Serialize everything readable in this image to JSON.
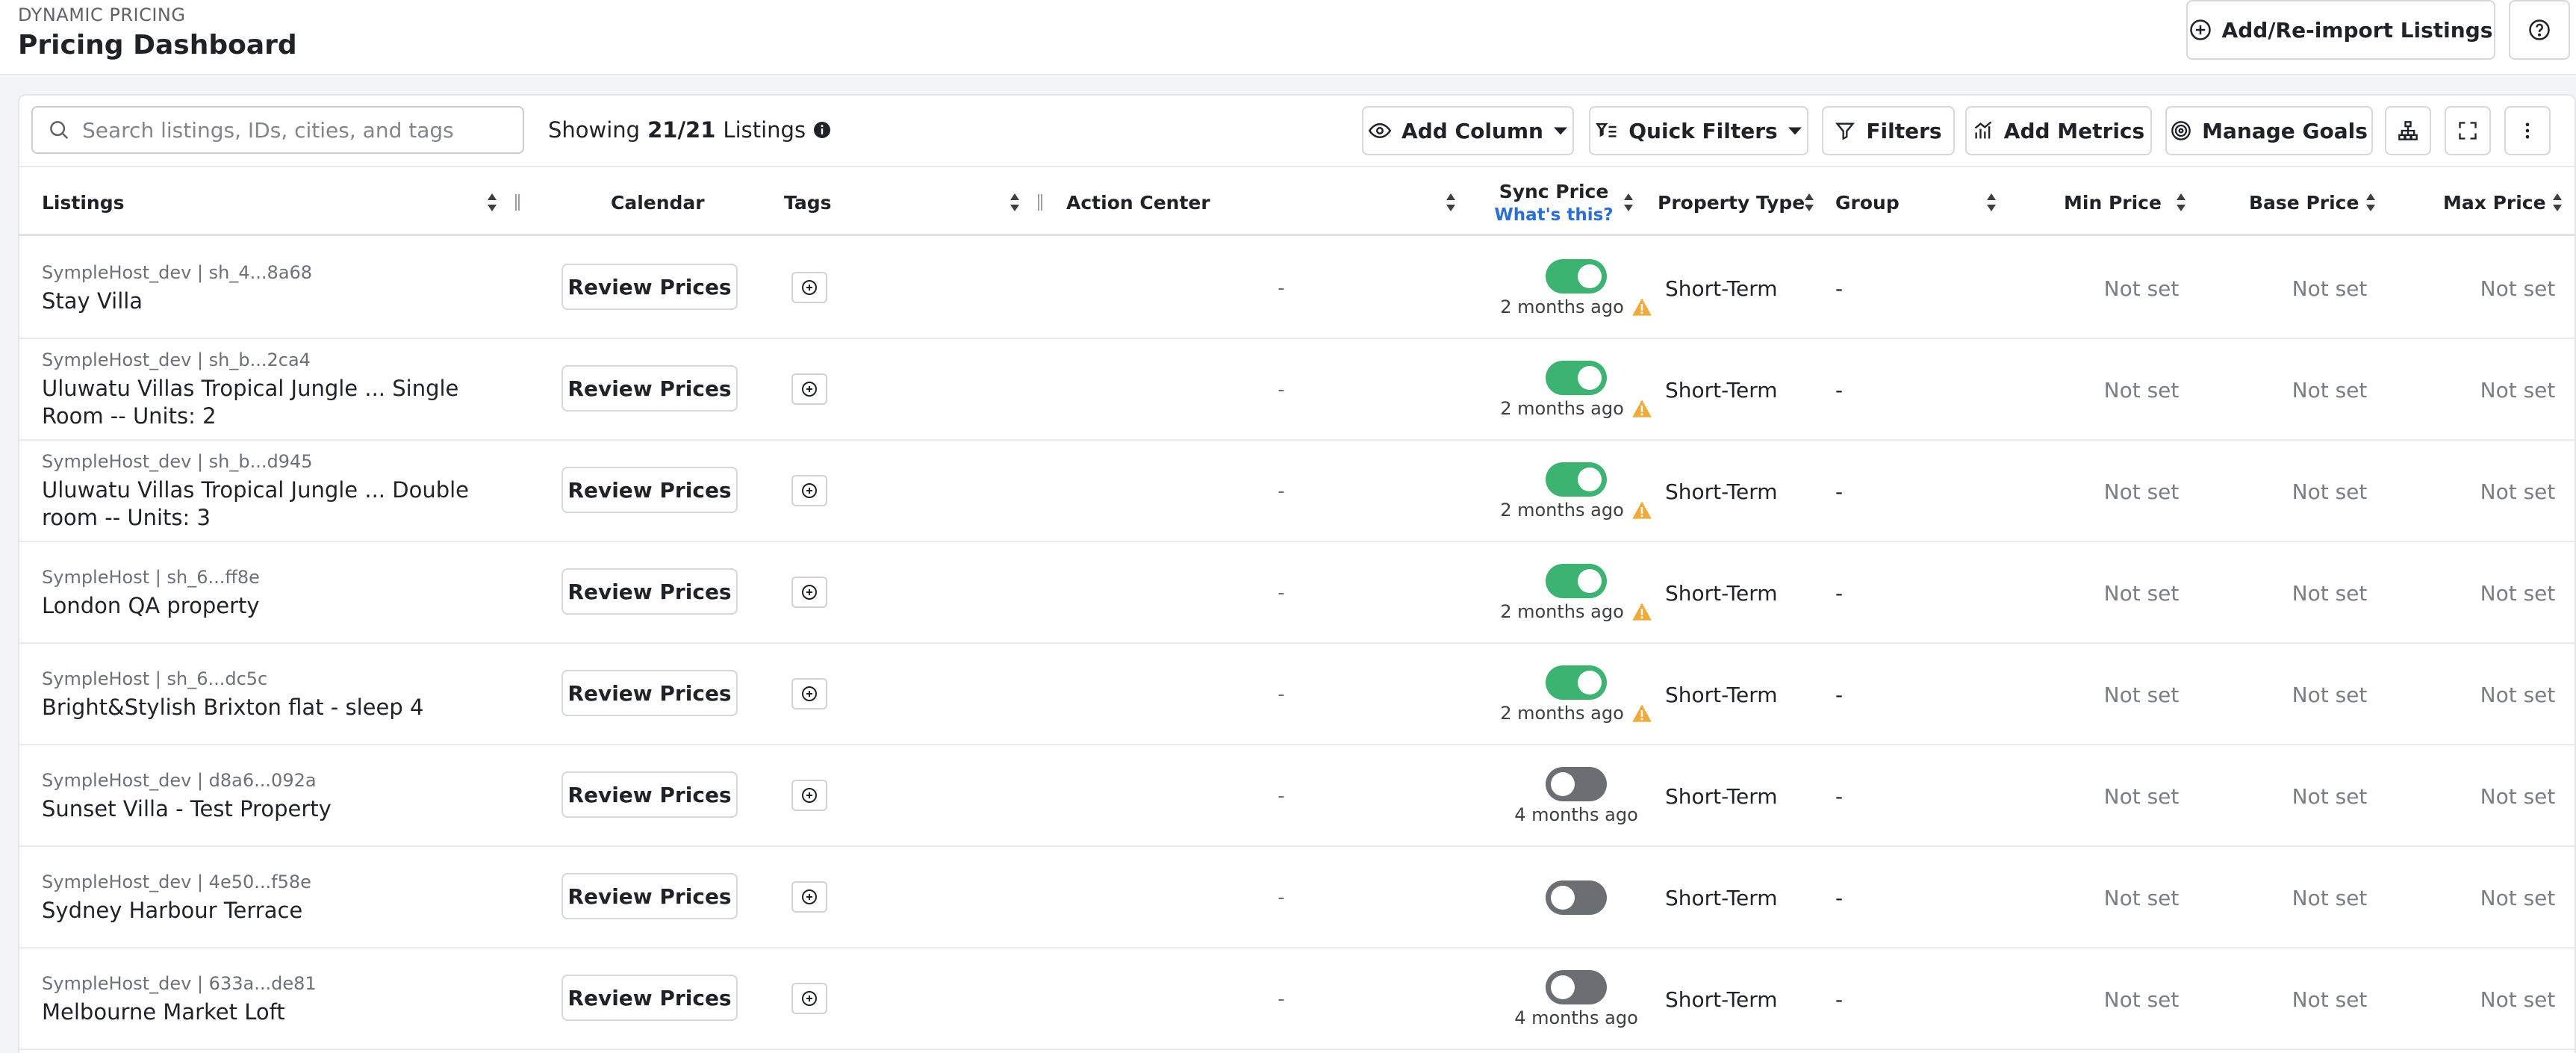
{
  "header": {
    "eyebrow": "DYNAMIC PRICING",
    "title": "Pricing Dashboard",
    "import_label": "Add/Re-import Listings"
  },
  "toolbar": {
    "search_placeholder": "Search listings, IDs, cities, and tags",
    "showing_prefix": "Showing",
    "showing_count": "21/21",
    "showing_suffix": "Listings",
    "add_column": "Add Column",
    "quick_filters": "Quick Filters",
    "filters": "Filters",
    "add_metrics": "Add Metrics",
    "manage_goals": "Manage Goals"
  },
  "columns": {
    "listings": "Listings",
    "calendar": "Calendar",
    "tags": "Tags",
    "action_center": "Action Center",
    "sync_price": "Sync Price",
    "sync_help": "What's this?",
    "property_type": "Property Type",
    "group": "Group",
    "min_price": "Min Price",
    "base_price": "Base Price",
    "max_price": "Max Price"
  },
  "row_labels": {
    "review": "Review Prices",
    "empty": "-"
  },
  "rows": [
    {
      "meta": "SympleHost_dev | sh_4...8a68",
      "name": "Stay Villa",
      "sync_on": true,
      "sync_time": "2 months ago",
      "warning": true,
      "property_type": "Short-Term",
      "group": "-",
      "min_price": "Not set",
      "base_price": "Not set",
      "max_price": "Not set"
    },
    {
      "meta": "SympleHost_dev | sh_b...2ca4",
      "name": "Uluwatu Villas Tropical Jungle ... Single Room -- Units: 2",
      "sync_on": true,
      "sync_time": "2 months ago",
      "warning": true,
      "property_type": "Short-Term",
      "group": "-",
      "min_price": "Not set",
      "base_price": "Not set",
      "max_price": "Not set"
    },
    {
      "meta": "SympleHost_dev | sh_b...d945",
      "name": "Uluwatu Villas Tropical Jungle ... Double room -- Units: 3",
      "sync_on": true,
      "sync_time": "2 months ago",
      "warning": true,
      "property_type": "Short-Term",
      "group": "-",
      "min_price": "Not set",
      "base_price": "Not set",
      "max_price": "Not set"
    },
    {
      "meta": "SympleHost | sh_6...ff8e",
      "name": "London QA property",
      "sync_on": true,
      "sync_time": "2 months ago",
      "warning": true,
      "property_type": "Short-Term",
      "group": "-",
      "min_price": "Not set",
      "base_price": "Not set",
      "max_price": "Not set"
    },
    {
      "meta": "SympleHost | sh_6...dc5c",
      "name": "Bright&Stylish Brixton flat - sleep 4",
      "sync_on": true,
      "sync_time": "2 months ago",
      "warning": true,
      "property_type": "Short-Term",
      "group": "-",
      "min_price": "Not set",
      "base_price": "Not set",
      "max_price": "Not set"
    },
    {
      "meta": "SympleHost_dev | d8a6...092a",
      "name": "Sunset Villa - Test Property",
      "sync_on": false,
      "sync_time": "4 months ago",
      "warning": false,
      "property_type": "Short-Term",
      "group": "-",
      "min_price": "Not set",
      "base_price": "Not set",
      "max_price": "Not set"
    },
    {
      "meta": "SympleHost_dev | 4e50...f58e",
      "name": "Sydney Harbour Terrace",
      "sync_on": false,
      "sync_time": "",
      "warning": false,
      "property_type": "Short-Term",
      "group": "-",
      "min_price": "Not set",
      "base_price": "Not set",
      "max_price": "Not set"
    },
    {
      "meta": "SympleHost_dev | 633a...de81",
      "name": "Melbourne Market Loft",
      "sync_on": false,
      "sync_time": "4 months ago",
      "warning": false,
      "property_type": "Short-Term",
      "group": "-",
      "min_price": "Not set",
      "base_price": "Not set",
      "max_price": "Not set"
    }
  ],
  "colors": {
    "toggle_on": "#3cb371",
    "toggle_off": "#6b6e72",
    "warning": "#f0a93b",
    "link": "#2b6fd6"
  }
}
